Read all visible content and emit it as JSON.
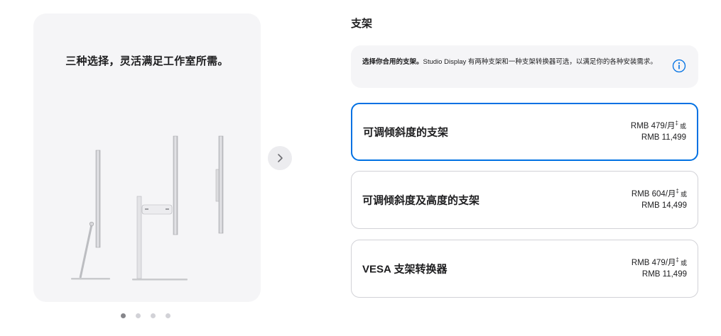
{
  "gallery": {
    "title": "三种选择，灵活满足工作室所需。",
    "next_icon": "chevron-right-icon",
    "dots": [
      {
        "active": true
      },
      {
        "active": false
      },
      {
        "active": false
      },
      {
        "active": false
      }
    ]
  },
  "section": {
    "title": "支架"
  },
  "info": {
    "bold_text": "选择你合用的支架。",
    "text": "Studio Display 有两种支架和一种支架转换器可选，以满足你的各种安装需求。",
    "icon": "info-icon"
  },
  "options": [
    {
      "label": "可调倾斜度的支架",
      "monthly": "RMB 479/月",
      "dagger": "‡",
      "or": "或",
      "full": "RMB 11,499",
      "selected": true
    },
    {
      "label": "可调倾斜度及高度的支架",
      "monthly": "RMB 604/月",
      "dagger": "‡",
      "or": "或",
      "full": "RMB 14,499",
      "selected": false
    },
    {
      "label": "VESA 支架转换器",
      "monthly": "RMB 479/月",
      "dagger": "‡",
      "or": "或",
      "full": "RMB 11,499",
      "selected": false
    }
  ],
  "colors": {
    "accent": "#0071e3",
    "card_bg": "#f5f5f7",
    "border": "#d2d2d7"
  }
}
